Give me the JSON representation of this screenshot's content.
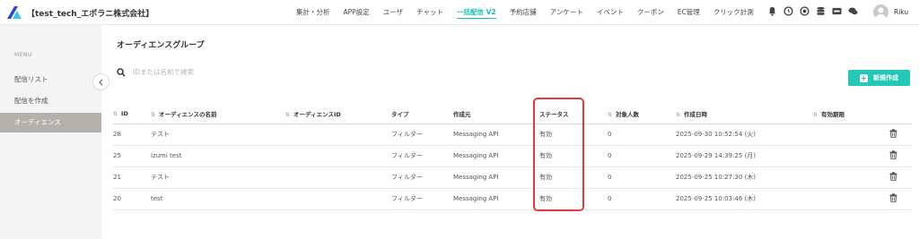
{
  "header": {
    "company": "【test_tech_エポラニ株式会社】",
    "nav": [
      {
        "label": "集計・分析",
        "active": false
      },
      {
        "label": "APP設定",
        "active": false
      },
      {
        "label": "ユーザ",
        "active": false
      },
      {
        "label": "チャット",
        "active": false
      },
      {
        "label": "一括配信 V2",
        "active": true
      },
      {
        "label": "予約店舗",
        "active": false
      },
      {
        "label": "アンケート",
        "active": false
      },
      {
        "label": "イベント",
        "active": false
      },
      {
        "label": "クーポン",
        "active": false
      },
      {
        "label": "EC管理",
        "active": false
      },
      {
        "label": "クリック計測",
        "active": false
      }
    ],
    "username": "Riku",
    "accent_color": "#1fc1b3"
  },
  "sidebar": {
    "menu_label": "MENU",
    "items": [
      {
        "label": "配信リスト",
        "active": false
      },
      {
        "label": "配信を作成",
        "active": false
      },
      {
        "label": "オーディエンス",
        "active": true
      }
    ]
  },
  "main": {
    "title": "オーディエンスグループ",
    "search_placeholder": "IDまたは名前で検索",
    "new_button": "新規作成",
    "columns": [
      "ID",
      "オーディエンスの名前",
      "オーディエンスID",
      "タイプ",
      "作成元",
      "ステータス",
      "対象人数",
      "作成日時",
      "有効期限"
    ],
    "rows": [
      {
        "id": "28",
        "name": "テスト",
        "audience_id": "",
        "type": "フィルター",
        "source": "Messaging API",
        "status": "有効",
        "count": "0",
        "created": "2025-09-30 10:52:54 (火)",
        "expires": ""
      },
      {
        "id": "25",
        "name": "izumi test",
        "audience_id": "",
        "type": "フィルター",
        "source": "Messaging API",
        "status": "有効",
        "count": "0",
        "created": "2025-09-29 14:39:25 (月)",
        "expires": ""
      },
      {
        "id": "21",
        "name": "テスト",
        "audience_id": "",
        "type": "フィルター",
        "source": "Messaging API",
        "status": "有効",
        "count": "0",
        "created": "2025-09-25 10:27:30 (木)",
        "expires": ""
      },
      {
        "id": "20",
        "name": "test",
        "audience_id": "",
        "type": "フィルター",
        "source": "Messaging API",
        "status": "有効",
        "count": "0",
        "created": "2025-09-25 10:03:46 (木)",
        "expires": ""
      }
    ],
    "highlight_color": "#e03a3a",
    "button_color": "#25c7b8"
  }
}
